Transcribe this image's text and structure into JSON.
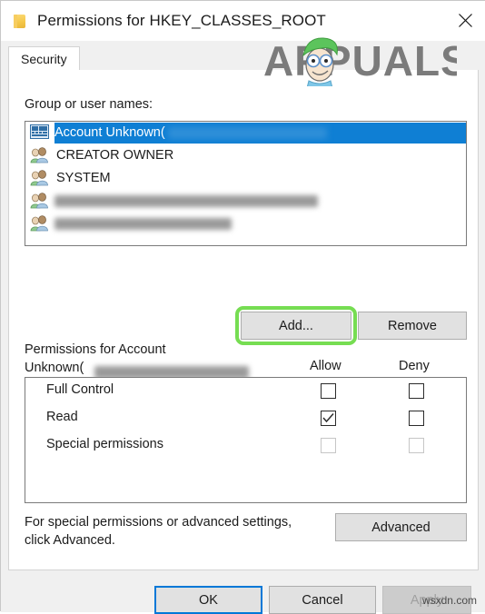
{
  "window": {
    "title": "Permissions for HKEY_CLASSES_ROOT",
    "icon": "folder-icon",
    "close_icon": "close-icon"
  },
  "tabs": [
    {
      "label": "Security",
      "active": true
    }
  ],
  "group_list": {
    "label": "Group or user names:",
    "items": [
      {
        "name": "Account Unknown(",
        "icon": "unknown-account-icon",
        "selected": true,
        "redacted": true
      },
      {
        "name": "CREATOR OWNER",
        "icon": "users-group-icon",
        "selected": false,
        "redacted": false
      },
      {
        "name": "SYSTEM",
        "icon": "users-group-icon",
        "selected": false,
        "redacted": false
      },
      {
        "name": "",
        "icon": "users-group-icon",
        "selected": false,
        "redacted": true
      },
      {
        "name": "",
        "icon": "users-group-icon",
        "selected": false,
        "redacted": true
      }
    ]
  },
  "list_buttons": {
    "add_label": "Add...",
    "remove_label": "Remove",
    "highlight_color": "#76dd52",
    "highlighted": "add-button"
  },
  "permissions": {
    "label_line1": "Permissions for Account",
    "label_line2": "Unknown(",
    "columns": [
      "Allow",
      "Deny"
    ],
    "rows": [
      {
        "name": "Full Control",
        "allow": false,
        "deny": false,
        "enabled": true
      },
      {
        "name": "Read",
        "allow": true,
        "deny": false,
        "enabled": true
      },
      {
        "name": "Special permissions",
        "allow": false,
        "deny": false,
        "enabled": false
      }
    ]
  },
  "advanced": {
    "hint_line1": "For special permissions or advanced settings,",
    "hint_line2": "click Advanced.",
    "button_label": "Advanced"
  },
  "footer": {
    "ok_label": "OK",
    "cancel_label": "Cancel",
    "apply_label": "Apply",
    "apply_disabled": true,
    "default_button": "ok-button"
  },
  "watermarks": {
    "brand": "APPUALS",
    "site": "wsxdn.com"
  }
}
